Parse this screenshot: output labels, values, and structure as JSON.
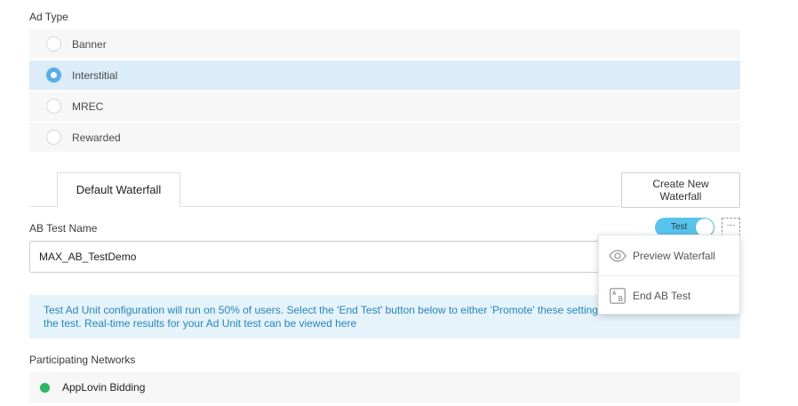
{
  "ad_type": {
    "label": "Ad Type",
    "options": [
      {
        "label": "Banner",
        "selected": false
      },
      {
        "label": "Interstitial",
        "selected": true
      },
      {
        "label": "MREC",
        "selected": false
      },
      {
        "label": "Rewarded",
        "selected": false
      }
    ]
  },
  "waterfall": {
    "tab_label": "Default Waterfall",
    "create_button_label": "Create New Waterfall"
  },
  "ab_test": {
    "label": "AB Test Name",
    "toggle_label": "Test",
    "toggle_on": true,
    "more_label": "···",
    "name_value": "MAX_AB_TestDemo"
  },
  "menu": {
    "items": [
      {
        "label": "Preview Waterfall",
        "icon": "eye-icon"
      },
      {
        "label": "End AB Test",
        "icon": "ab-test-icon"
      }
    ]
  },
  "info": {
    "text": "Test Ad Unit configuration will run on 50% of users. Select the 'End Test' button below to either 'Promote' these settings to",
    "text_line2": "the test. Real-time results for your Ad Unit test can be viewed",
    "link": "here"
  },
  "networks": {
    "label": "Participating Networks",
    "items": [
      {
        "label": "AppLovin Bidding",
        "status_color": "#2db665"
      }
    ]
  },
  "colors": {
    "accent": "#5aaee8",
    "selected_row": "#dcedf9",
    "toggle": "#58c3ec",
    "info_text": "#2585bd",
    "info_bg": "#e6f3fa"
  }
}
